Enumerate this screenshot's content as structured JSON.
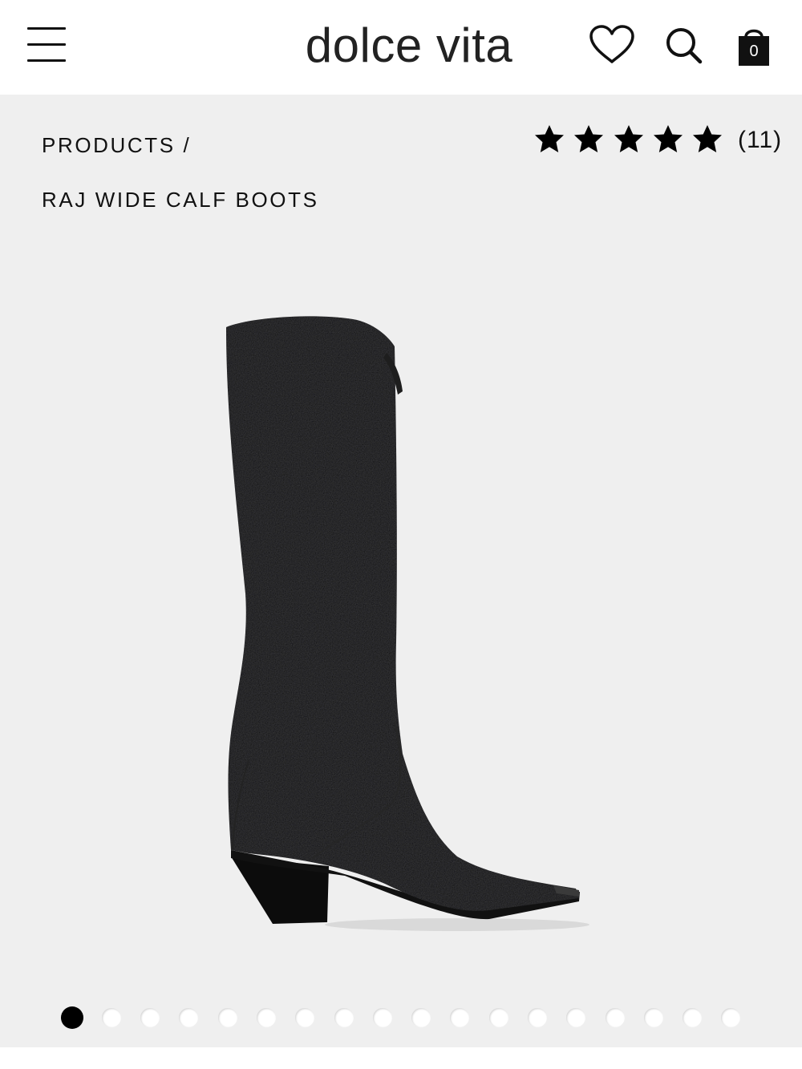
{
  "header": {
    "logo_text": "dolce vita",
    "bag_count": "0",
    "icons": {
      "menu": "menu-icon",
      "wishlist": "heart-icon",
      "search": "search-icon",
      "bag": "shopping-bag-icon"
    }
  },
  "breadcrumb": {
    "label": "PRODUCTS /"
  },
  "product": {
    "title": "RAJ WIDE CALF BOOTS",
    "rating": 5,
    "rating_max": 5,
    "review_count": "(11)",
    "image_description_icon": "boot-image"
  },
  "gallery": {
    "total_images": 18,
    "active_index": 0
  },
  "colors": {
    "header_bg": "#ffffff",
    "gallery_bg": "#efefef",
    "text": "#111111",
    "active_dot": "#000000"
  }
}
